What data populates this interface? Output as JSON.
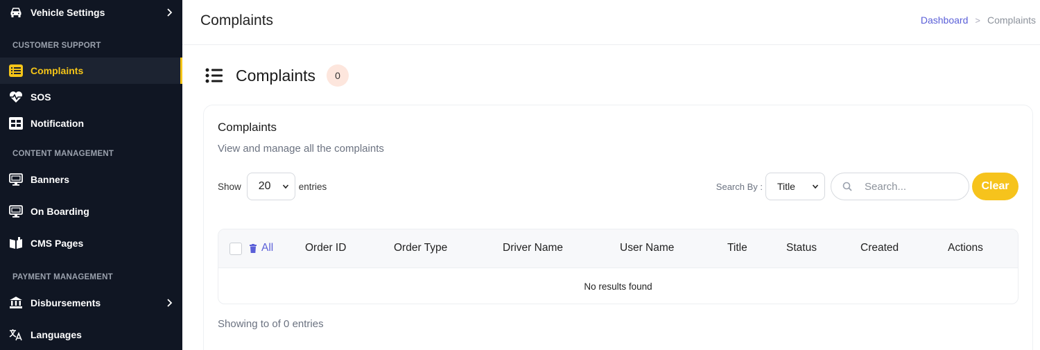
{
  "sidebar": {
    "items": [
      {
        "label": "Vehicle Settings",
        "icon": "car-icon"
      },
      {
        "label": "Complaints",
        "icon": "list-box-icon"
      },
      {
        "label": "SOS",
        "icon": "heart-pulse-icon"
      },
      {
        "label": "Notification",
        "icon": "grid-box-icon"
      },
      {
        "label": "Banners",
        "icon": "monitor-icon"
      },
      {
        "label": "On Boarding",
        "icon": "monitor-icon"
      },
      {
        "label": "CMS Pages",
        "icon": "book-icon"
      },
      {
        "label": "Disbursements",
        "icon": "bank-icon"
      },
      {
        "label": "Languages",
        "icon": "translate-icon"
      }
    ],
    "sections": {
      "customer_support": "CUSTOMER SUPPORT",
      "content_management": "CONTENT MANAGEMENT",
      "payment_management": "PAYMENT MANAGEMENT"
    },
    "active_item": "Complaints"
  },
  "header": {
    "title": "Complaints",
    "breadcrumb": {
      "link": "Dashboard",
      "separator": ">",
      "current": "Complaints"
    }
  },
  "heading": {
    "title": "Complaints",
    "count": "0"
  },
  "card": {
    "title": "Complaints",
    "subtitle": "View and manage all the complaints",
    "show_label": "Show",
    "entries_value": "20",
    "entries_label": "entries",
    "search_by_label": "Search By :",
    "search_by_value": "Title",
    "search_placeholder": "Search...",
    "clear_label": "Clear"
  },
  "table": {
    "all_label": "All",
    "columns": [
      "Order ID",
      "Order Type",
      "Driver Name",
      "User Name",
      "Title",
      "Status",
      "Created",
      "Actions"
    ],
    "empty_message": "No results found",
    "footer": "Showing to of 0 entries"
  },
  "colors": {
    "sidebar_bg": "#101623",
    "accent": "#f5c518",
    "link": "#5a5fd8",
    "badge_bg": "#fde6dd"
  }
}
